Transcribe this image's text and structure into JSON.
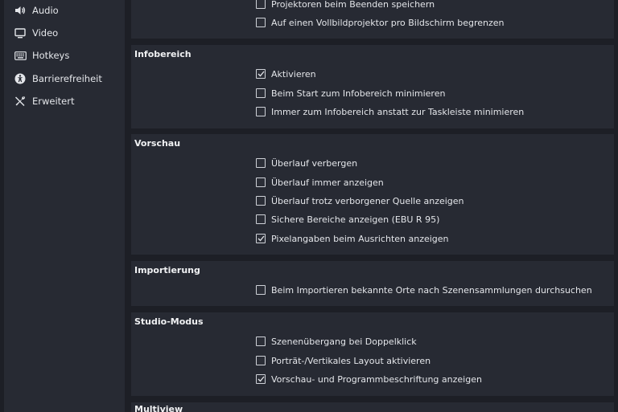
{
  "sidebar": {
    "items": [
      {
        "label": "Audio",
        "icon": "speaker-icon"
      },
      {
        "label": "Video",
        "icon": "monitor-icon"
      },
      {
        "label": "Hotkeys",
        "icon": "keyboard-icon"
      },
      {
        "label": "Barrierefreiheit",
        "icon": "accessibility-icon"
      },
      {
        "label": "Erweitert",
        "icon": "tools-icon"
      }
    ]
  },
  "sections": {
    "projektoren": {
      "options": [
        {
          "label": "Projektoren beim Beenden speichern",
          "checked": false
        },
        {
          "label": "Auf einen Vollbildprojektor pro Bildschirm begrenzen",
          "checked": false
        }
      ]
    },
    "infobereich": {
      "title": "Infobereich",
      "options": [
        {
          "label": "Aktivieren",
          "checked": true
        },
        {
          "label": "Beim Start zum Infobereich minimieren",
          "checked": false
        },
        {
          "label": "Immer zum Infobereich anstatt zur Taskleiste minimieren",
          "checked": false
        }
      ]
    },
    "vorschau": {
      "title": "Vorschau",
      "options": [
        {
          "label": "Überlauf verbergen",
          "checked": false
        },
        {
          "label": "Überlauf immer anzeigen",
          "checked": false
        },
        {
          "label": "Überlauf trotz verborgener Quelle anzeigen",
          "checked": false
        },
        {
          "label": "Sichere Bereiche anzeigen (EBU R 95)",
          "checked": false
        },
        {
          "label": "Pixelangaben beim Ausrichten anzeigen",
          "checked": true
        }
      ]
    },
    "importierung": {
      "title": "Importierung",
      "options": [
        {
          "label": "Beim Importieren bekannte Orte nach Szenensammlungen durchsuchen",
          "checked": false
        }
      ]
    },
    "studio": {
      "title": "Studio-Modus",
      "options": [
        {
          "label": "Szenenübergang bei Doppelklick",
          "checked": false
        },
        {
          "label": "Porträt-/Vertikales Layout aktivieren",
          "checked": false
        },
        {
          "label": "Vorschau- und Programmbeschriftung anzeigen",
          "checked": true
        }
      ]
    },
    "multiview": {
      "title": "Multiview"
    }
  }
}
